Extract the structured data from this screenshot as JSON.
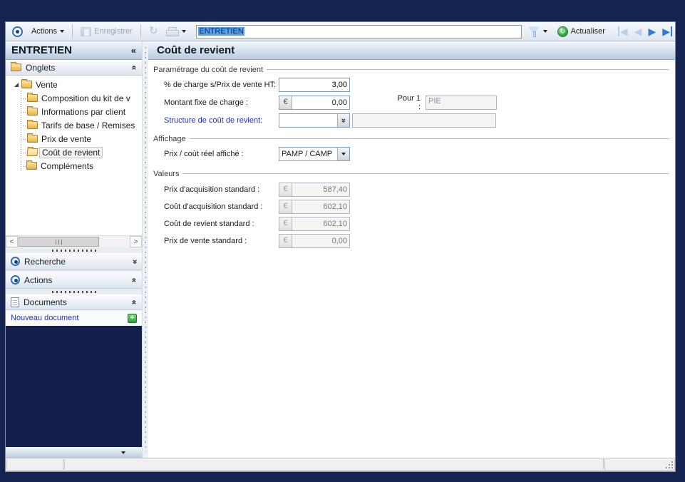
{
  "colors": {
    "desktop_background": "#152351",
    "header_gradient_bottom": "#b9cadf",
    "selection_blue": "#55a2e8",
    "link_blue": "#2130bf",
    "nav_enabled_blue": "#2e7cd6",
    "actualiser_green": "#2e9e3e"
  },
  "glyphs": {
    "collapse_sidebar": "«",
    "chevron_double": "«",
    "scroll_left": "<",
    "scroll_right": ">",
    "nav_prev": "◀",
    "nav_next": "▶",
    "refresh": "↻",
    "plus": "+"
  },
  "toolbar": {
    "actions_label": "Actions",
    "save_label": "Enregistrer",
    "record_value": "ENTRETIEN",
    "refresh_label": "Actualiser"
  },
  "sidebar": {
    "title": "ENTRETIEN",
    "onglets_label": "Onglets",
    "recherche_label": "Recherche",
    "actions_label": "Actions",
    "documents_label": "Documents",
    "new_document_label": "Nouveau document",
    "tree": {
      "items": [
        {
          "label": "Vente",
          "level": 0,
          "expanded": true
        },
        {
          "label": "Composition du kit de v",
          "level": 1
        },
        {
          "label": "Informations par client",
          "level": 1
        },
        {
          "label": "Tarifs de base / Remises",
          "level": 1
        },
        {
          "label": "Prix de vente",
          "level": 1
        },
        {
          "label": "Coût de revient",
          "level": 1,
          "selected": true
        },
        {
          "label": "Compléments",
          "level": 0
        }
      ]
    }
  },
  "main": {
    "title": "Coût de revient",
    "currency": "€",
    "parametrage": {
      "legend": "Paramétrage du coût de revient",
      "pct_label": "% de charge s/Prix de vente HT:",
      "pct_value": "3,00",
      "montant_label": "Montant fixe de charge :",
      "montant_value": "0,00",
      "pour_label": "Pour 1 :",
      "pour_value": "PIE",
      "structure_label": "Structure de coût de revient:",
      "structure_value": "",
      "structure_detail_value": ""
    },
    "affichage": {
      "legend": "Affichage",
      "prix_label": "Prix / coût réel affiché :",
      "prix_value": "PAMP / CAMP"
    },
    "valeurs": {
      "legend": "Valeurs",
      "rows": [
        {
          "label": "Prix d'acquisition standard :",
          "value": "587,40"
        },
        {
          "label": "Coût d'acquisition standard :",
          "value": "602,10"
        },
        {
          "label": "Coût de revient standard :",
          "value": "602,10"
        },
        {
          "label": "Prix de vente standard :",
          "value": "0,00"
        }
      ]
    }
  }
}
